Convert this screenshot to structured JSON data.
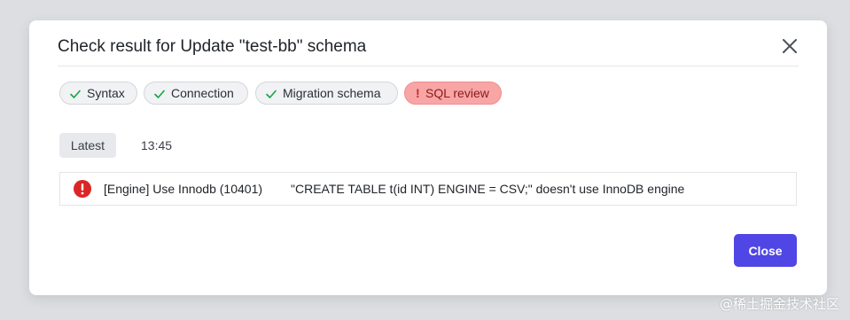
{
  "dialog": {
    "title": "Check result for Update \"test-bb\" schema"
  },
  "checks": [
    {
      "label": "Syntax",
      "status": "success",
      "icon": "check-icon"
    },
    {
      "label": "Connection",
      "status": "success",
      "icon": "check-icon"
    },
    {
      "label": "Migration schema",
      "status": "success",
      "icon": "check-icon"
    },
    {
      "label": "SQL review",
      "status": "error",
      "icon": "exclamation-icon"
    }
  ],
  "history": {
    "tag": "Latest",
    "time": "13:45"
  },
  "result": {
    "icon": "error-circle-icon",
    "rule": "[Engine] Use Innodb (10401)",
    "message": "\"CREATE TABLE t(id INT) ENGINE = CSV;\" doesn't use InnoDB engine"
  },
  "footer": {
    "close_label": "Close"
  },
  "watermark": "@稀土掘金技术社区",
  "colors": {
    "primary": "#4f46e5",
    "success": "#16a34a",
    "error": "#dc2626",
    "error_chip_bg": "#f8a5a5"
  }
}
